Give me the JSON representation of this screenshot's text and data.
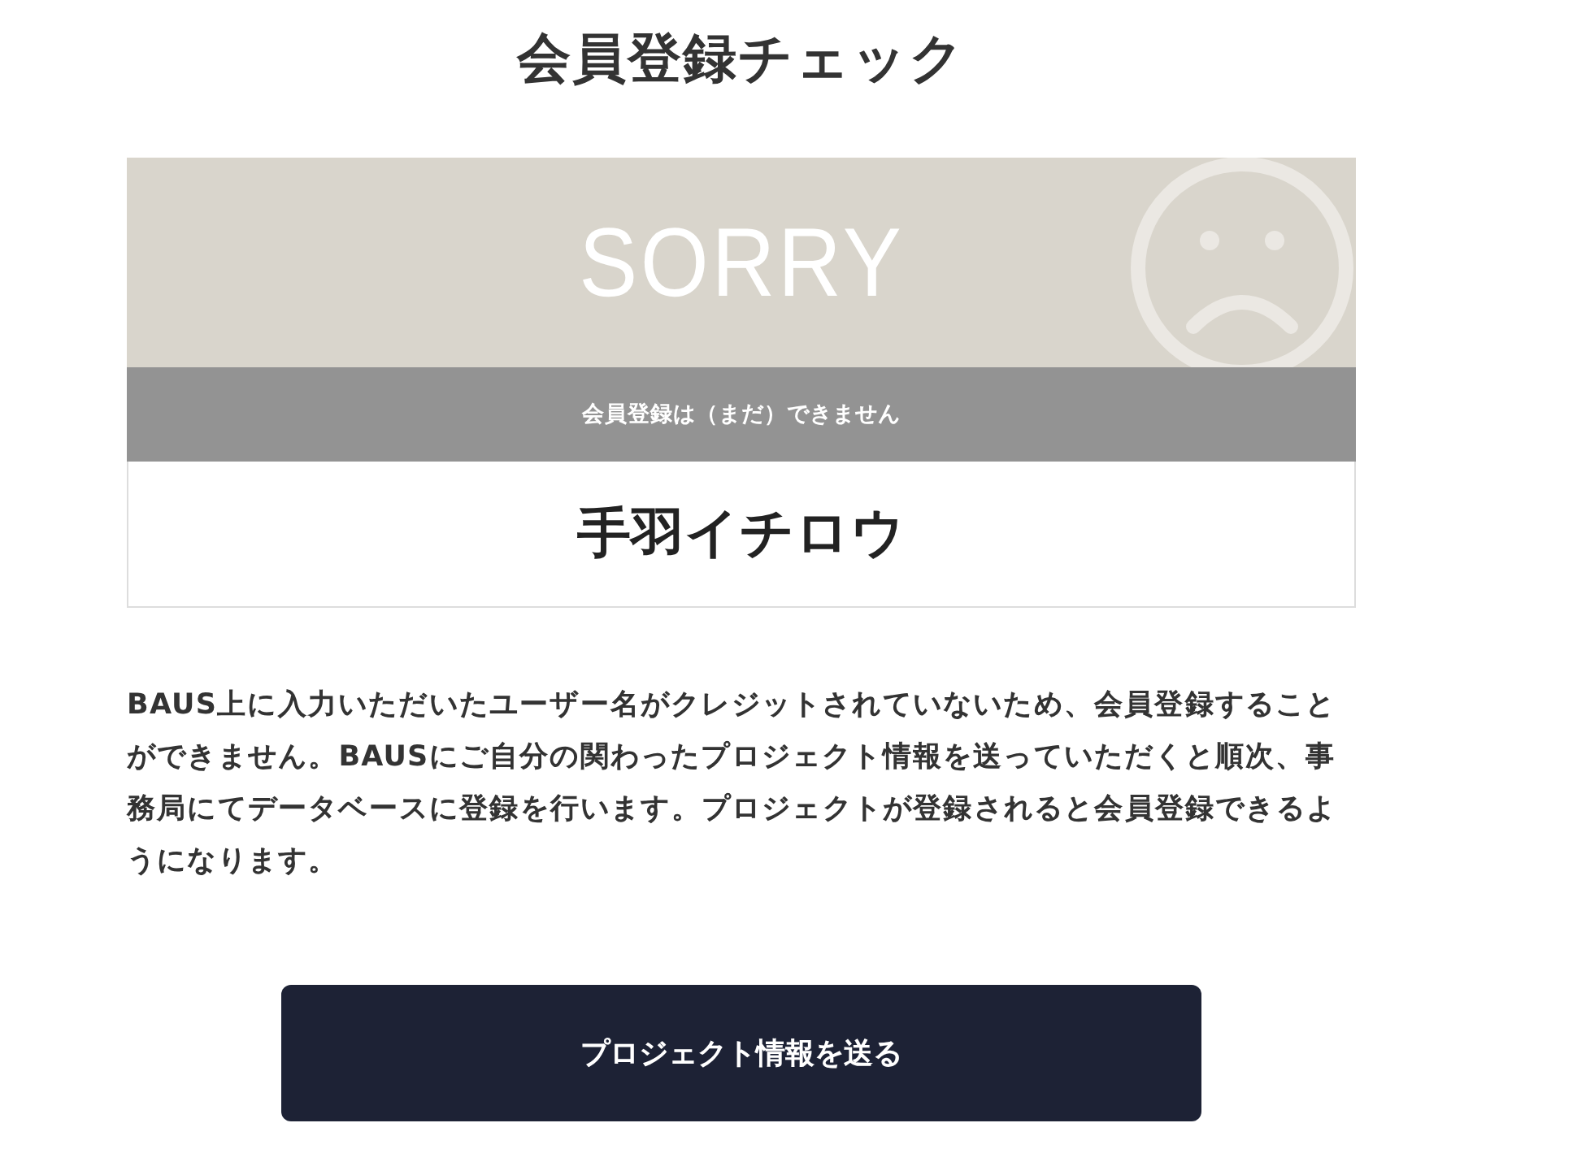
{
  "page": {
    "title": "会員登録チェック"
  },
  "result_card": {
    "headline": "SORRY",
    "status": "会員登録は（まだ）できません",
    "name": "手羽イチロウ"
  },
  "message": "BAUS上に入力いただいたユーザー名がクレジットされていないため、会員登録することができません。BAUSにご自分の関わったプロジェクト情報を送っていただくと順次、事務局にてデータベースに登録を行います。プロジェクトが登録されると会員登録できるようになります。",
  "button": {
    "label": "プロジェクト情報を送る"
  }
}
